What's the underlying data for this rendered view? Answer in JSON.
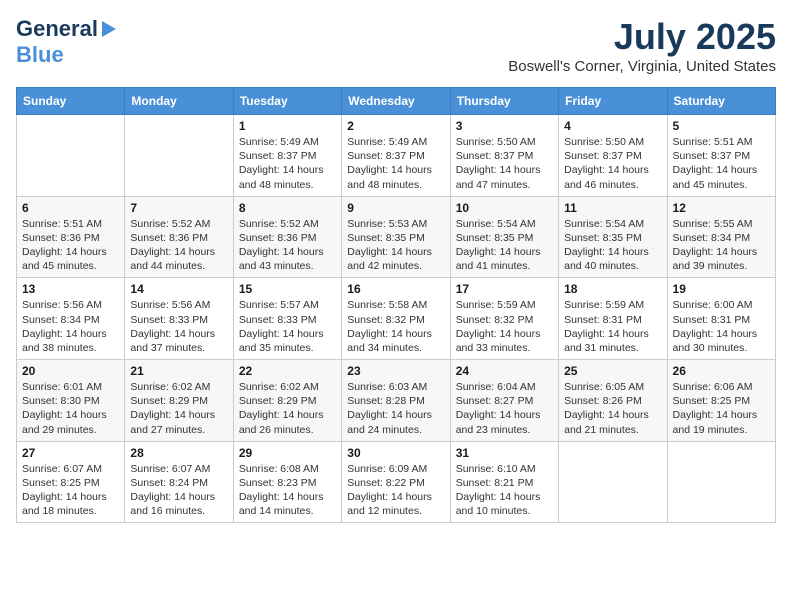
{
  "header": {
    "logo_line1": "General",
    "logo_line2": "Blue",
    "month_year": "July 2025",
    "location": "Boswell's Corner, Virginia, United States"
  },
  "weekdays": [
    "Sunday",
    "Monday",
    "Tuesday",
    "Wednesday",
    "Thursday",
    "Friday",
    "Saturday"
  ],
  "weeks": [
    [
      {
        "day": "",
        "info": ""
      },
      {
        "day": "",
        "info": ""
      },
      {
        "day": "1",
        "info": "Sunrise: 5:49 AM\nSunset: 8:37 PM\nDaylight: 14 hours and 48 minutes."
      },
      {
        "day": "2",
        "info": "Sunrise: 5:49 AM\nSunset: 8:37 PM\nDaylight: 14 hours and 48 minutes."
      },
      {
        "day": "3",
        "info": "Sunrise: 5:50 AM\nSunset: 8:37 PM\nDaylight: 14 hours and 47 minutes."
      },
      {
        "day": "4",
        "info": "Sunrise: 5:50 AM\nSunset: 8:37 PM\nDaylight: 14 hours and 46 minutes."
      },
      {
        "day": "5",
        "info": "Sunrise: 5:51 AM\nSunset: 8:37 PM\nDaylight: 14 hours and 45 minutes."
      }
    ],
    [
      {
        "day": "6",
        "info": "Sunrise: 5:51 AM\nSunset: 8:36 PM\nDaylight: 14 hours and 45 minutes."
      },
      {
        "day": "7",
        "info": "Sunrise: 5:52 AM\nSunset: 8:36 PM\nDaylight: 14 hours and 44 minutes."
      },
      {
        "day": "8",
        "info": "Sunrise: 5:52 AM\nSunset: 8:36 PM\nDaylight: 14 hours and 43 minutes."
      },
      {
        "day": "9",
        "info": "Sunrise: 5:53 AM\nSunset: 8:35 PM\nDaylight: 14 hours and 42 minutes."
      },
      {
        "day": "10",
        "info": "Sunrise: 5:54 AM\nSunset: 8:35 PM\nDaylight: 14 hours and 41 minutes."
      },
      {
        "day": "11",
        "info": "Sunrise: 5:54 AM\nSunset: 8:35 PM\nDaylight: 14 hours and 40 minutes."
      },
      {
        "day": "12",
        "info": "Sunrise: 5:55 AM\nSunset: 8:34 PM\nDaylight: 14 hours and 39 minutes."
      }
    ],
    [
      {
        "day": "13",
        "info": "Sunrise: 5:56 AM\nSunset: 8:34 PM\nDaylight: 14 hours and 38 minutes."
      },
      {
        "day": "14",
        "info": "Sunrise: 5:56 AM\nSunset: 8:33 PM\nDaylight: 14 hours and 37 minutes."
      },
      {
        "day": "15",
        "info": "Sunrise: 5:57 AM\nSunset: 8:33 PM\nDaylight: 14 hours and 35 minutes."
      },
      {
        "day": "16",
        "info": "Sunrise: 5:58 AM\nSunset: 8:32 PM\nDaylight: 14 hours and 34 minutes."
      },
      {
        "day": "17",
        "info": "Sunrise: 5:59 AM\nSunset: 8:32 PM\nDaylight: 14 hours and 33 minutes."
      },
      {
        "day": "18",
        "info": "Sunrise: 5:59 AM\nSunset: 8:31 PM\nDaylight: 14 hours and 31 minutes."
      },
      {
        "day": "19",
        "info": "Sunrise: 6:00 AM\nSunset: 8:31 PM\nDaylight: 14 hours and 30 minutes."
      }
    ],
    [
      {
        "day": "20",
        "info": "Sunrise: 6:01 AM\nSunset: 8:30 PM\nDaylight: 14 hours and 29 minutes."
      },
      {
        "day": "21",
        "info": "Sunrise: 6:02 AM\nSunset: 8:29 PM\nDaylight: 14 hours and 27 minutes."
      },
      {
        "day": "22",
        "info": "Sunrise: 6:02 AM\nSunset: 8:29 PM\nDaylight: 14 hours and 26 minutes."
      },
      {
        "day": "23",
        "info": "Sunrise: 6:03 AM\nSunset: 8:28 PM\nDaylight: 14 hours and 24 minutes."
      },
      {
        "day": "24",
        "info": "Sunrise: 6:04 AM\nSunset: 8:27 PM\nDaylight: 14 hours and 23 minutes."
      },
      {
        "day": "25",
        "info": "Sunrise: 6:05 AM\nSunset: 8:26 PM\nDaylight: 14 hours and 21 minutes."
      },
      {
        "day": "26",
        "info": "Sunrise: 6:06 AM\nSunset: 8:25 PM\nDaylight: 14 hours and 19 minutes."
      }
    ],
    [
      {
        "day": "27",
        "info": "Sunrise: 6:07 AM\nSunset: 8:25 PM\nDaylight: 14 hours and 18 minutes."
      },
      {
        "day": "28",
        "info": "Sunrise: 6:07 AM\nSunset: 8:24 PM\nDaylight: 14 hours and 16 minutes."
      },
      {
        "day": "29",
        "info": "Sunrise: 6:08 AM\nSunset: 8:23 PM\nDaylight: 14 hours and 14 minutes."
      },
      {
        "day": "30",
        "info": "Sunrise: 6:09 AM\nSunset: 8:22 PM\nDaylight: 14 hours and 12 minutes."
      },
      {
        "day": "31",
        "info": "Sunrise: 6:10 AM\nSunset: 8:21 PM\nDaylight: 14 hours and 10 minutes."
      },
      {
        "day": "",
        "info": ""
      },
      {
        "day": "",
        "info": ""
      }
    ]
  ]
}
